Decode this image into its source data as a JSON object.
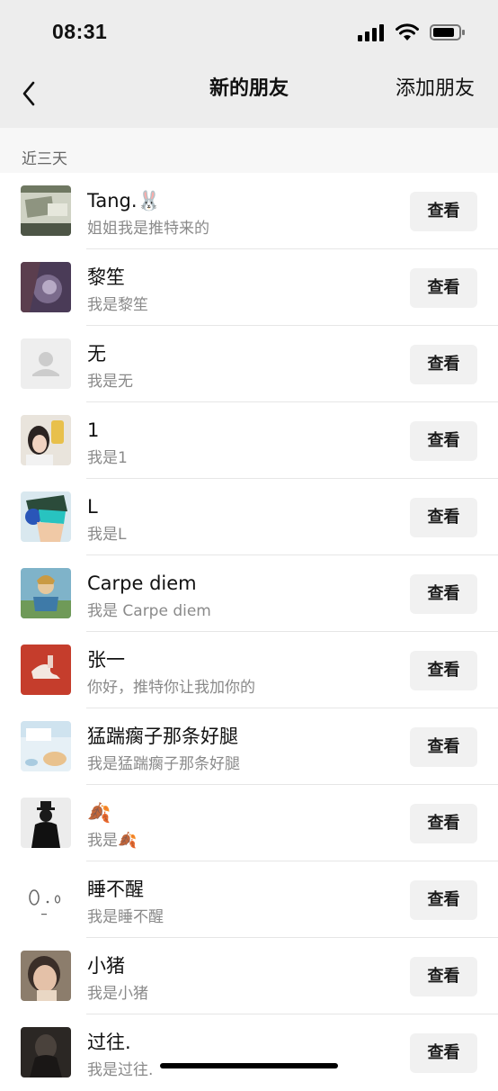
{
  "status_bar": {
    "time": "08:31"
  },
  "nav": {
    "title": "新的朋友",
    "action": "添加朋友"
  },
  "section": {
    "label": "近三天"
  },
  "view_label": "查看",
  "requests": [
    {
      "name": "Tang.🐰",
      "message": "姐姐我是推特来的"
    },
    {
      "name": "黎笙",
      "message": "我是黎笙"
    },
    {
      "name": "无",
      "message": "我是无"
    },
    {
      "name": "1",
      "message": "我是1"
    },
    {
      "name": "L",
      "message": "我是L"
    },
    {
      "name": "Carpe diem",
      "message": "我是 Carpe diem"
    },
    {
      "name": "张一",
      "message": "你好，推特你让我加你的"
    },
    {
      "name": "猛踹瘸子那条好腿",
      "message": "我是猛踹瘸子那条好腿"
    },
    {
      "name": "🍂",
      "message": "我是🍂"
    },
    {
      "name": "睡不醒",
      "message": "我是睡不醒"
    },
    {
      "name": "小猪",
      "message": "我是小猪"
    },
    {
      "name": "过往.",
      "message": "我是过往."
    }
  ]
}
